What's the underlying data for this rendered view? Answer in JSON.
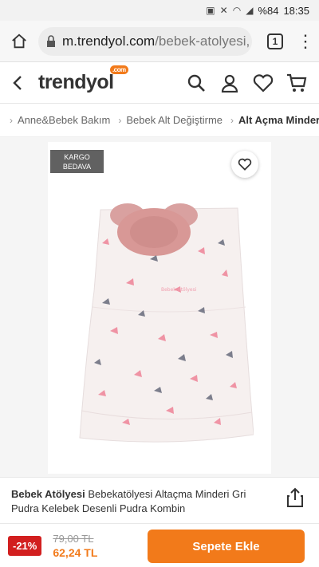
{
  "status_bar": {
    "icons": [
      "image-icon",
      "mute-icon",
      "wifi-icon",
      "signal-icon"
    ],
    "battery": "%84",
    "time": "18:35"
  },
  "browser": {
    "url_host": "m.trendyol.com",
    "url_path": "/bebek-atolyesi,",
    "tab_count": "1"
  },
  "site": {
    "logo": "trendyol",
    "logo_badge": ".com",
    "accent": "#f27a1a"
  },
  "breadcrumb": {
    "items": [
      "Anne&Bebek Bakım",
      "Bebek Alt Değiştirme",
      "Alt Açma Minderi"
    ]
  },
  "product": {
    "badge": "KARGO BEDAVA",
    "brand": "Bebek Atölyesi",
    "title": "Bebekatölyesi Altaçma Minderi Gri Pudra Kelebek Desenli Pudra Kombin",
    "image_watermark": "Bebek Atölyesi"
  },
  "purchase": {
    "discount": "-21%",
    "old_price": "79,00 TL",
    "new_price": "62,24 TL",
    "cart_label": "Sepete Ekle",
    "discount_color": "#d21f1f"
  }
}
